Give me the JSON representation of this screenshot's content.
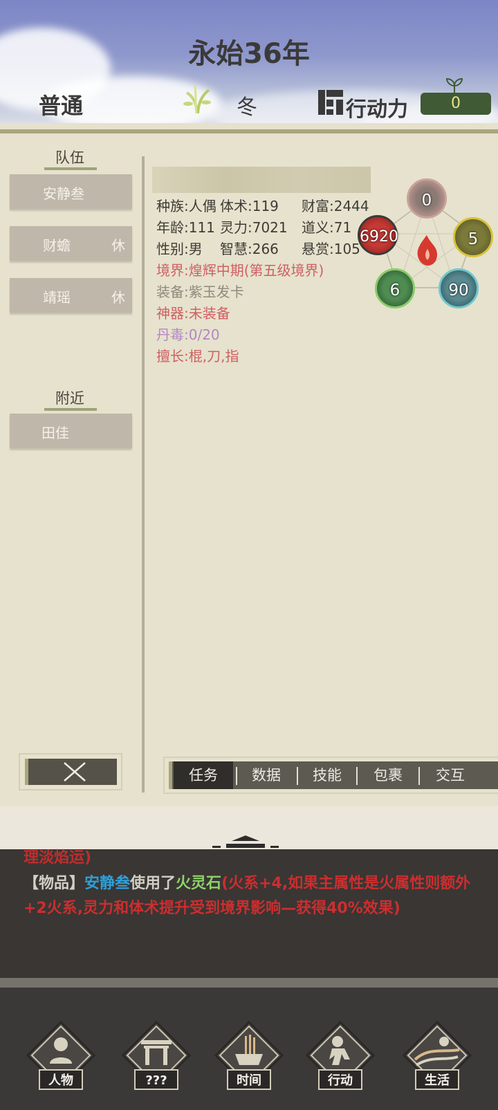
{
  "header": {
    "year_title": "永始36年",
    "difficulty": "普通",
    "season": "冬",
    "action_label": "行动力",
    "action_value": "0"
  },
  "sidebar": {
    "team_label": "队伍",
    "members": [
      {
        "name": "安静叁",
        "status": ""
      },
      {
        "name": "财蟾",
        "status": "休"
      },
      {
        "name": "靖瑶",
        "status": "休"
      }
    ],
    "nearby_label": "附近",
    "nearby": [
      {
        "name": "田佳"
      }
    ]
  },
  "character": {
    "race": "种族:人偶",
    "body": "体术:119",
    "wealth": "财富:2444",
    "age": "年龄:111",
    "spirit": "灵力:7021",
    "morality": "道义:71",
    "gender": "性别:男",
    "wisdom": "智慧:266",
    "bounty": "悬赏:105",
    "realm": "境界:煌辉中期(第五级境界)",
    "equipment": "装备:紫玉发卡",
    "artifact": "神器:未装备",
    "pill_poison": "丹毒:0/20",
    "specialty": "擅长:棍,刀,指"
  },
  "elements": {
    "metal": "0",
    "fire": "6920",
    "earth": "5",
    "wood": "6",
    "water": "90"
  },
  "tabs": [
    "任务",
    "数据",
    "技能",
    "包裹",
    "交互"
  ],
  "log": {
    "cut_line": "理淡焰运)",
    "prefix": "【物品】",
    "actor": "安静叁",
    "verb": "使用了",
    "item": "火灵石",
    "effect": "(火系+4,如果主属性是火属性则额外+2火系,灵力和体术提升受到境界影响—获得40%效果)"
  },
  "nav": [
    "人物",
    "???",
    "时间",
    "行动",
    "生活"
  ],
  "colors": {
    "sky": "#7c86c6",
    "panel": "#e6e2cd",
    "realm_red": "#cf5f63",
    "log_red": "#cc2e2e",
    "log_blue": "#2f9fd6",
    "log_green": "#8fd36a"
  }
}
